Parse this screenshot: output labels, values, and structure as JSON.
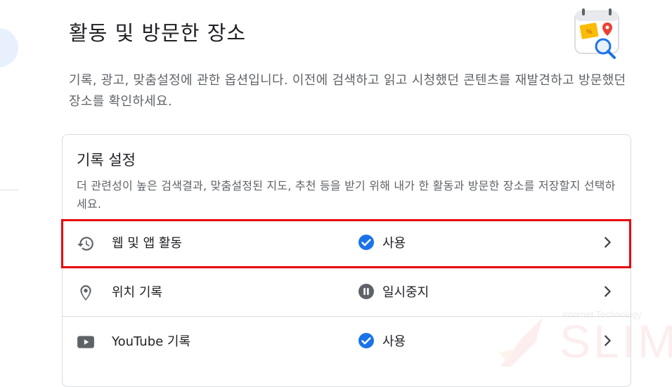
{
  "page": {
    "title": "활동 및 방문한 장소",
    "description": "기록, 광고, 맞춤설정에 관한 옵션입니다. 이전에 검색하고 읽고 시청했던 콘텐츠를 재발견하고 방문했던 장소를 확인하세요."
  },
  "card": {
    "title": "기록 설정",
    "description": "더 관련성이 높은 검색결과, 맞춤설정된 지도, 추천 등을 받기 위해 내가 한 활동과 방문한 장소를 저장할지 선택하세요.",
    "rows": [
      {
        "label": "웹 및 앱 활동",
        "status": "사용",
        "icon": "history-icon",
        "status_icon": "check-circle-icon"
      },
      {
        "label": "위치 기록",
        "status": "일시중지",
        "icon": "location-pin-icon",
        "status_icon": "pause-circle-icon"
      },
      {
        "label": "YouTube 기록",
        "status": "사용",
        "icon": "youtube-icon",
        "status_icon": "check-circle-icon"
      }
    ]
  },
  "watermark": {
    "small": "Internet Technology",
    "big": "SLIM"
  },
  "colors": {
    "accent_blue": "#1a73e8",
    "highlight_red": "#e8000b",
    "muted_text": "#5f6368"
  }
}
